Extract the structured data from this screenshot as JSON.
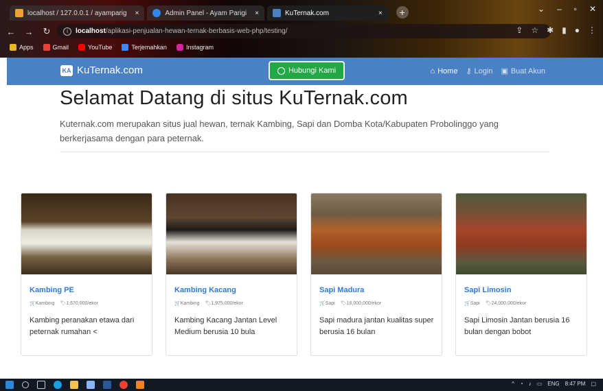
{
  "browser": {
    "tabs": [
      {
        "label": "localhost / 127.0.0.1 / ayamparig",
        "close": "×",
        "active": false
      },
      {
        "label": "Admin Panel - Ayam Parigi",
        "close": "×",
        "active": false
      },
      {
        "label": "KuTernak.com",
        "close": "×",
        "active": true
      }
    ],
    "new_tab": "+",
    "url_host": "localhost",
    "url_path": "/aplikasi-penjualan-hewan-ternak-berbasis-web-php/testing/",
    "bookmarks": [
      "Apps",
      "Gmail",
      "YouTube",
      "Terjemahkan",
      "Instagram"
    ]
  },
  "navbar": {
    "brand": "KuTernak.com",
    "brand_logo": "KA",
    "contact_button": "Hubungi Kami",
    "links": {
      "home": "Home",
      "login": "Login",
      "register": "Buat Akun"
    }
  },
  "hero": {
    "title": "Selamat Datang di situs KuTernak.com",
    "description": "Kuternak.com merupakan situs jual hewan, ternak Kambing, Sapi dan Domba Kota/Kabupaten Probolinggo yang berkerjasama dengan para peternak."
  },
  "products": [
    {
      "title": "Kambing PE",
      "category": "Kambing",
      "price": "1,670,000/ekor",
      "description": "Kambing peranakan etawa dari peternak rumahan <"
    },
    {
      "title": "Kambing Kacang",
      "category": "Kambing",
      "price": "1,975,000/ekor",
      "description": "Kambing Kacang Jantan Level Medium berusia 10 bula"
    },
    {
      "title": "Sapi Madura",
      "category": "Sapi",
      "price": "16,000,000/ekor",
      "description": "Sapi madura jantan kualitas super berusia 16 bulan"
    },
    {
      "title": "Sapi Limosin",
      "category": "Sapi",
      "price": "24,000,000/ekor",
      "description": "Sapi Limosin Jantan berusia 16 bulan dengan bobot"
    }
  ],
  "taskbar": {
    "tray": {
      "lang": "ENG",
      "time": "8:47 PM"
    }
  },
  "colors": {
    "navbar": "#4a80c4",
    "contact": "#22a845",
    "link": "#2f7ad6"
  }
}
